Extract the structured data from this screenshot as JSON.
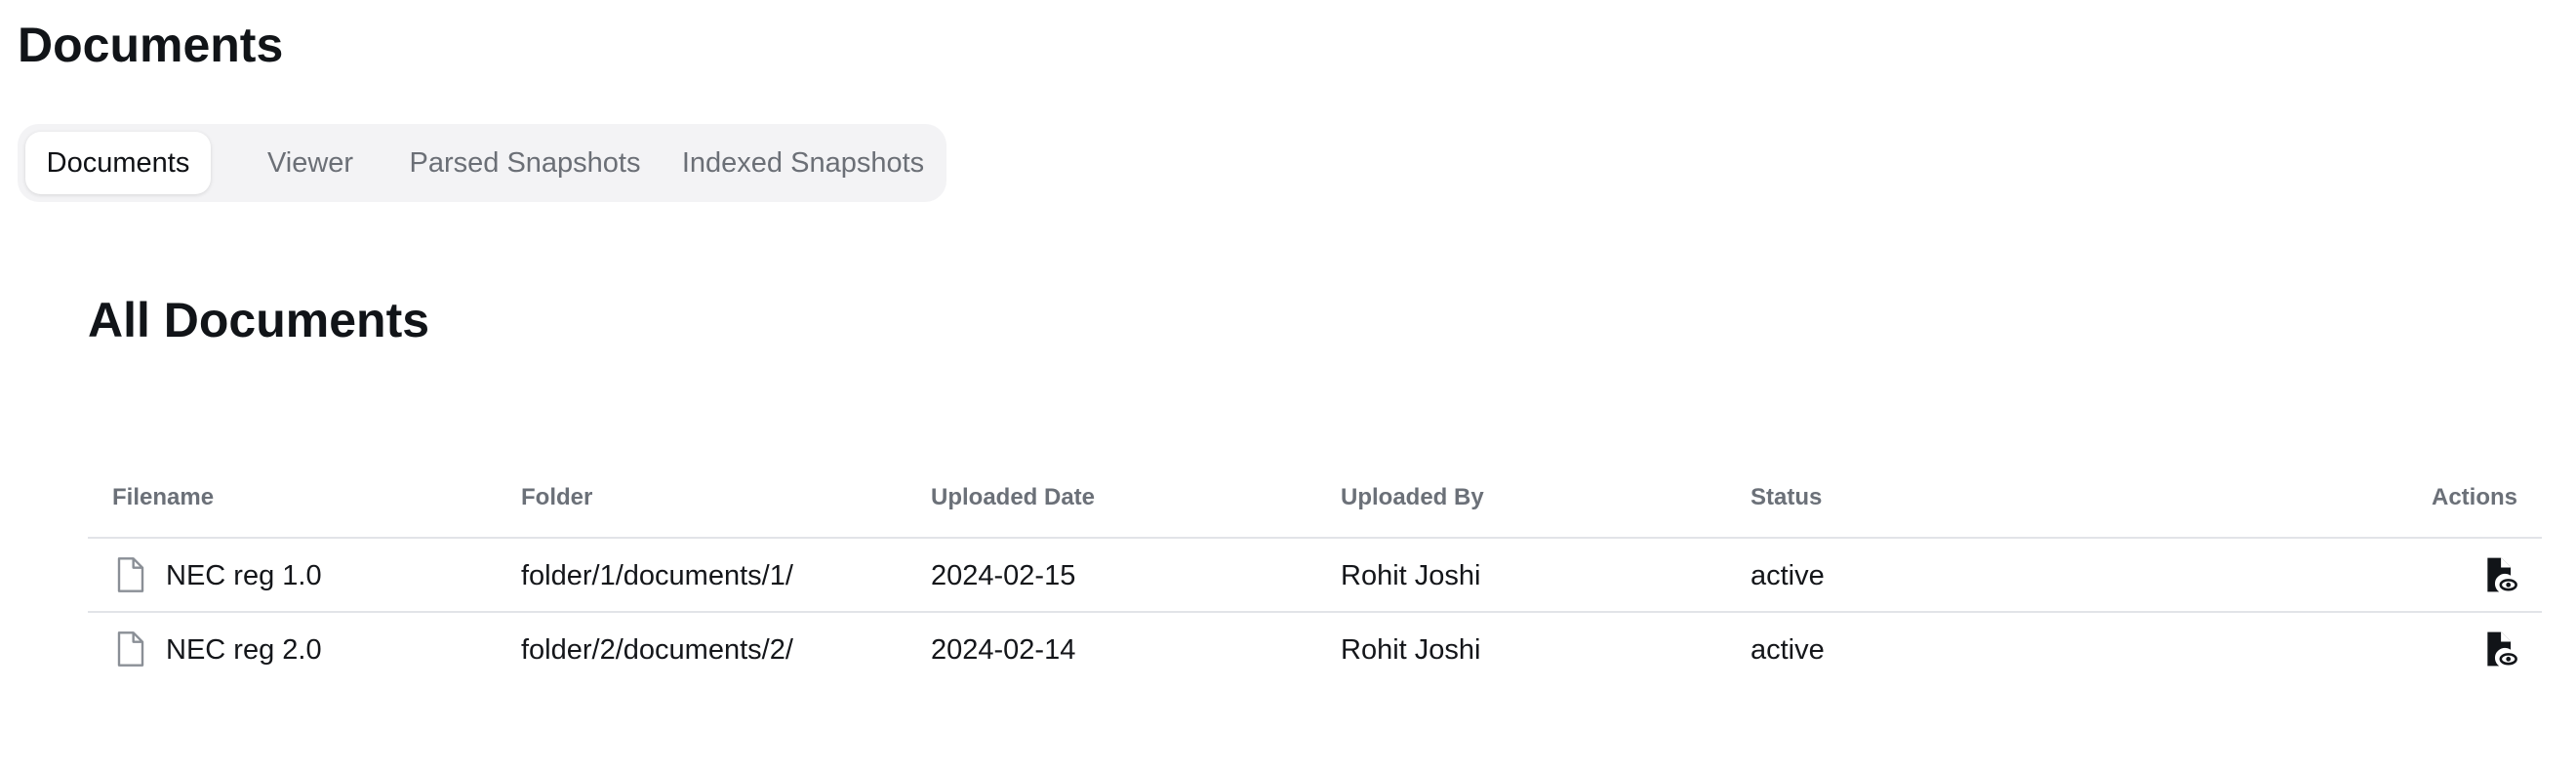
{
  "page": {
    "title": "Documents"
  },
  "tabs": [
    {
      "label": "Documents",
      "active": true
    },
    {
      "label": "Viewer",
      "active": false
    },
    {
      "label": "Parsed Snapshots",
      "active": false
    },
    {
      "label": "Indexed Snapshots",
      "active": false
    }
  ],
  "section": {
    "title": "All Documents"
  },
  "table": {
    "headers": {
      "filename": "Filename",
      "folder": "Folder",
      "uploaded_date": "Uploaded Date",
      "uploaded_by": "Uploaded By",
      "status": "Status",
      "actions": "Actions"
    },
    "rows": [
      {
        "filename": "NEC reg 1.0",
        "folder": "folder/1/documents/1/",
        "uploaded_date": "2024-02-15",
        "uploaded_by": "Rohit Joshi",
        "status": "active",
        "file_icon": "file-outline-icon",
        "action_icon": "file-view-icon"
      },
      {
        "filename": "NEC reg 2.0",
        "folder": "folder/2/documents/2/",
        "uploaded_date": "2024-02-14",
        "uploaded_by": "Rohit Joshi",
        "status": "active",
        "file_icon": "file-outline-icon",
        "action_icon": "file-view-icon"
      }
    ]
  },
  "colors": {
    "active_tab_bg": "#ffffff",
    "tab_bar_bg": "#f3f3f5",
    "muted_text": "#6b7078",
    "row_divider": "#e2e4e8"
  }
}
